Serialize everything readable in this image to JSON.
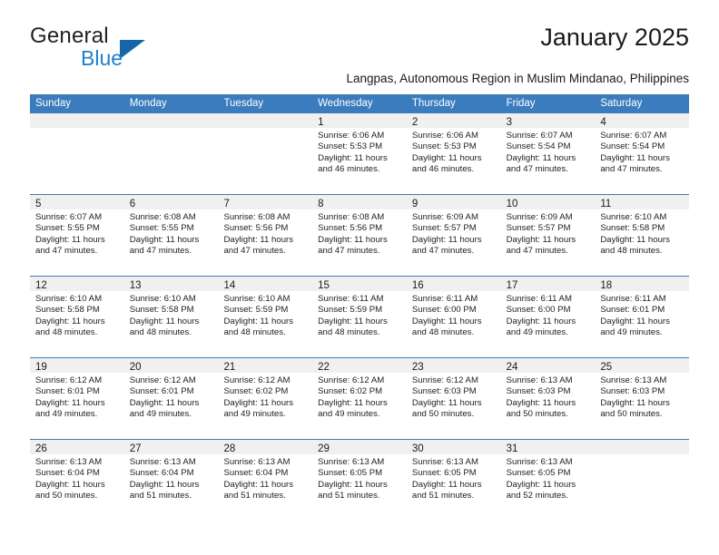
{
  "brand": {
    "name_part1": "General",
    "name_part2": "Blue",
    "triangle_color": "#1565a8",
    "blue_color": "#1f7fd0"
  },
  "header": {
    "month_title": "January 2025",
    "location": "Langpas, Autonomous Region in Muslim Mindanao, Philippines"
  },
  "calendar": {
    "header_bg": "#3a7cbe",
    "day_band_bg": "#f0f0f0",
    "weekdays": [
      "Sunday",
      "Monday",
      "Tuesday",
      "Wednesday",
      "Thursday",
      "Friday",
      "Saturday"
    ],
    "weeks": [
      [
        {
          "day": "",
          "sunrise": "",
          "sunset": "",
          "daylight_line1": "",
          "daylight_line2": ""
        },
        {
          "day": "",
          "sunrise": "",
          "sunset": "",
          "daylight_line1": "",
          "daylight_line2": ""
        },
        {
          "day": "",
          "sunrise": "",
          "sunset": "",
          "daylight_line1": "",
          "daylight_line2": ""
        },
        {
          "day": "1",
          "sunrise": "Sunrise: 6:06 AM",
          "sunset": "Sunset: 5:53 PM",
          "daylight_line1": "Daylight: 11 hours",
          "daylight_line2": "and 46 minutes."
        },
        {
          "day": "2",
          "sunrise": "Sunrise: 6:06 AM",
          "sunset": "Sunset: 5:53 PM",
          "daylight_line1": "Daylight: 11 hours",
          "daylight_line2": "and 46 minutes."
        },
        {
          "day": "3",
          "sunrise": "Sunrise: 6:07 AM",
          "sunset": "Sunset: 5:54 PM",
          "daylight_line1": "Daylight: 11 hours",
          "daylight_line2": "and 47 minutes."
        },
        {
          "day": "4",
          "sunrise": "Sunrise: 6:07 AM",
          "sunset": "Sunset: 5:54 PM",
          "daylight_line1": "Daylight: 11 hours",
          "daylight_line2": "and 47 minutes."
        }
      ],
      [
        {
          "day": "5",
          "sunrise": "Sunrise: 6:07 AM",
          "sunset": "Sunset: 5:55 PM",
          "daylight_line1": "Daylight: 11 hours",
          "daylight_line2": "and 47 minutes."
        },
        {
          "day": "6",
          "sunrise": "Sunrise: 6:08 AM",
          "sunset": "Sunset: 5:55 PM",
          "daylight_line1": "Daylight: 11 hours",
          "daylight_line2": "and 47 minutes."
        },
        {
          "day": "7",
          "sunrise": "Sunrise: 6:08 AM",
          "sunset": "Sunset: 5:56 PM",
          "daylight_line1": "Daylight: 11 hours",
          "daylight_line2": "and 47 minutes."
        },
        {
          "day": "8",
          "sunrise": "Sunrise: 6:08 AM",
          "sunset": "Sunset: 5:56 PM",
          "daylight_line1": "Daylight: 11 hours",
          "daylight_line2": "and 47 minutes."
        },
        {
          "day": "9",
          "sunrise": "Sunrise: 6:09 AM",
          "sunset": "Sunset: 5:57 PM",
          "daylight_line1": "Daylight: 11 hours",
          "daylight_line2": "and 47 minutes."
        },
        {
          "day": "10",
          "sunrise": "Sunrise: 6:09 AM",
          "sunset": "Sunset: 5:57 PM",
          "daylight_line1": "Daylight: 11 hours",
          "daylight_line2": "and 47 minutes."
        },
        {
          "day": "11",
          "sunrise": "Sunrise: 6:10 AM",
          "sunset": "Sunset: 5:58 PM",
          "daylight_line1": "Daylight: 11 hours",
          "daylight_line2": "and 48 minutes."
        }
      ],
      [
        {
          "day": "12",
          "sunrise": "Sunrise: 6:10 AM",
          "sunset": "Sunset: 5:58 PM",
          "daylight_line1": "Daylight: 11 hours",
          "daylight_line2": "and 48 minutes."
        },
        {
          "day": "13",
          "sunrise": "Sunrise: 6:10 AM",
          "sunset": "Sunset: 5:58 PM",
          "daylight_line1": "Daylight: 11 hours",
          "daylight_line2": "and 48 minutes."
        },
        {
          "day": "14",
          "sunrise": "Sunrise: 6:10 AM",
          "sunset": "Sunset: 5:59 PM",
          "daylight_line1": "Daylight: 11 hours",
          "daylight_line2": "and 48 minutes."
        },
        {
          "day": "15",
          "sunrise": "Sunrise: 6:11 AM",
          "sunset": "Sunset: 5:59 PM",
          "daylight_line1": "Daylight: 11 hours",
          "daylight_line2": "and 48 minutes."
        },
        {
          "day": "16",
          "sunrise": "Sunrise: 6:11 AM",
          "sunset": "Sunset: 6:00 PM",
          "daylight_line1": "Daylight: 11 hours",
          "daylight_line2": "and 48 minutes."
        },
        {
          "day": "17",
          "sunrise": "Sunrise: 6:11 AM",
          "sunset": "Sunset: 6:00 PM",
          "daylight_line1": "Daylight: 11 hours",
          "daylight_line2": "and 49 minutes."
        },
        {
          "day": "18",
          "sunrise": "Sunrise: 6:11 AM",
          "sunset": "Sunset: 6:01 PM",
          "daylight_line1": "Daylight: 11 hours",
          "daylight_line2": "and 49 minutes."
        }
      ],
      [
        {
          "day": "19",
          "sunrise": "Sunrise: 6:12 AM",
          "sunset": "Sunset: 6:01 PM",
          "daylight_line1": "Daylight: 11 hours",
          "daylight_line2": "and 49 minutes."
        },
        {
          "day": "20",
          "sunrise": "Sunrise: 6:12 AM",
          "sunset": "Sunset: 6:01 PM",
          "daylight_line1": "Daylight: 11 hours",
          "daylight_line2": "and 49 minutes."
        },
        {
          "day": "21",
          "sunrise": "Sunrise: 6:12 AM",
          "sunset": "Sunset: 6:02 PM",
          "daylight_line1": "Daylight: 11 hours",
          "daylight_line2": "and 49 minutes."
        },
        {
          "day": "22",
          "sunrise": "Sunrise: 6:12 AM",
          "sunset": "Sunset: 6:02 PM",
          "daylight_line1": "Daylight: 11 hours",
          "daylight_line2": "and 49 minutes."
        },
        {
          "day": "23",
          "sunrise": "Sunrise: 6:12 AM",
          "sunset": "Sunset: 6:03 PM",
          "daylight_line1": "Daylight: 11 hours",
          "daylight_line2": "and 50 minutes."
        },
        {
          "day": "24",
          "sunrise": "Sunrise: 6:13 AM",
          "sunset": "Sunset: 6:03 PM",
          "daylight_line1": "Daylight: 11 hours",
          "daylight_line2": "and 50 minutes."
        },
        {
          "day": "25",
          "sunrise": "Sunrise: 6:13 AM",
          "sunset": "Sunset: 6:03 PM",
          "daylight_line1": "Daylight: 11 hours",
          "daylight_line2": "and 50 minutes."
        }
      ],
      [
        {
          "day": "26",
          "sunrise": "Sunrise: 6:13 AM",
          "sunset": "Sunset: 6:04 PM",
          "daylight_line1": "Daylight: 11 hours",
          "daylight_line2": "and 50 minutes."
        },
        {
          "day": "27",
          "sunrise": "Sunrise: 6:13 AM",
          "sunset": "Sunset: 6:04 PM",
          "daylight_line1": "Daylight: 11 hours",
          "daylight_line2": "and 51 minutes."
        },
        {
          "day": "28",
          "sunrise": "Sunrise: 6:13 AM",
          "sunset": "Sunset: 6:04 PM",
          "daylight_line1": "Daylight: 11 hours",
          "daylight_line2": "and 51 minutes."
        },
        {
          "day": "29",
          "sunrise": "Sunrise: 6:13 AM",
          "sunset": "Sunset: 6:05 PM",
          "daylight_line1": "Daylight: 11 hours",
          "daylight_line2": "and 51 minutes."
        },
        {
          "day": "30",
          "sunrise": "Sunrise: 6:13 AM",
          "sunset": "Sunset: 6:05 PM",
          "daylight_line1": "Daylight: 11 hours",
          "daylight_line2": "and 51 minutes."
        },
        {
          "day": "31",
          "sunrise": "Sunrise: 6:13 AM",
          "sunset": "Sunset: 6:05 PM",
          "daylight_line1": "Daylight: 11 hours",
          "daylight_line2": "and 52 minutes."
        },
        {
          "day": "",
          "sunrise": "",
          "sunset": "",
          "daylight_line1": "",
          "daylight_line2": ""
        }
      ]
    ]
  }
}
